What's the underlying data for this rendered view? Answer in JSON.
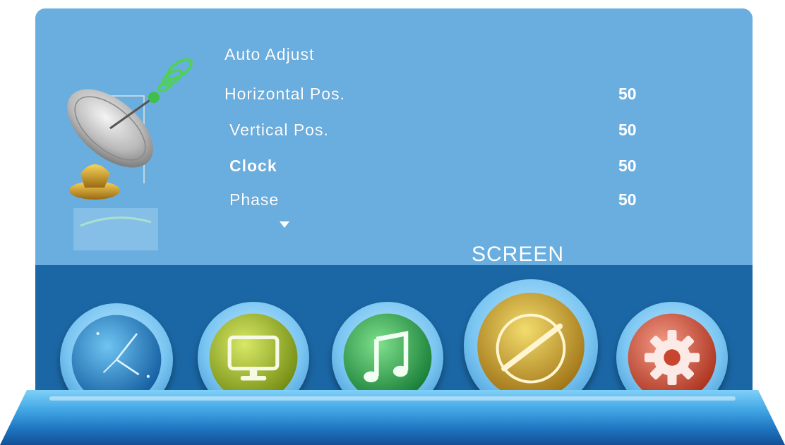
{
  "menu": {
    "title": "SCREEN",
    "items": [
      {
        "label": "Auto Adjust",
        "value": ""
      },
      {
        "label": "Horizontal Pos.",
        "value": "50"
      },
      {
        "label": "Vertical Pos.",
        "value": "50"
      },
      {
        "label": "Clock",
        "value": "50"
      },
      {
        "label": "Phase",
        "value": "50"
      }
    ],
    "more_indicator": "chevron-down-icon"
  },
  "tabs": [
    {
      "name": "clock-tab",
      "icon": "clock-icon"
    },
    {
      "name": "picture-tab",
      "icon": "monitor-icon"
    },
    {
      "name": "sound-tab",
      "icon": "music-note-icon"
    },
    {
      "name": "screen-tab",
      "icon": "dial-icon",
      "active": true
    },
    {
      "name": "setup-tab",
      "icon": "gear-icon"
    }
  ],
  "colors": {
    "panel": "#6aaee0",
    "band": "#1b67a5",
    "text": "#ffffff"
  },
  "side_icon": "satellite-dish-icon"
}
